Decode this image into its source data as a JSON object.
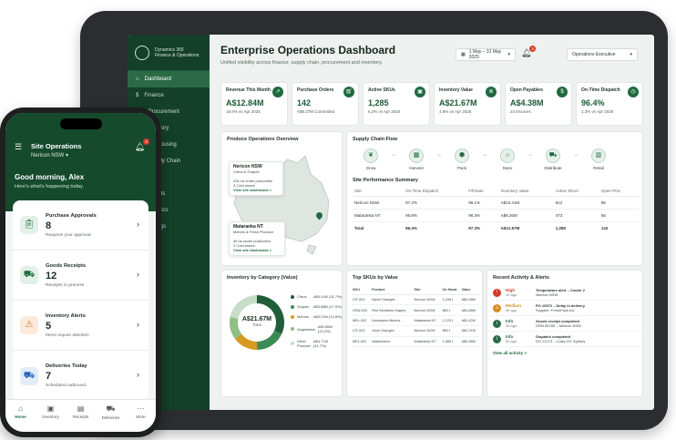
{
  "tablet": {
    "brand": {
      "line1": "Dynamics 365",
      "line2": "Finance & Operations"
    },
    "nav": [
      {
        "label": "Dashboard",
        "icon": "home-icon",
        "active": true
      },
      {
        "label": "Finance",
        "icon": "finance-icon"
      },
      {
        "label": "Procurement",
        "icon": "cart-icon"
      },
      {
        "label": "Inventory",
        "icon": "box-icon"
      },
      {
        "label": "Warehousing",
        "icon": "warehouse-icon"
      },
      {
        "label": "Supply Chain",
        "icon": "truck-icon"
      },
      {
        "label": "Sales",
        "icon": "tag-icon"
      },
      {
        "label": "Reports",
        "icon": "report-icon"
      },
      {
        "label": "Analytics",
        "icon": "chart-icon"
      },
      {
        "label": "Settings",
        "icon": "gear-icon"
      }
    ],
    "header": {
      "title": "Enterprise Operations Dashboard",
      "subtitle": "Unified visibility across finance, supply chain, procurement and inventory.",
      "date_range": "1 May – 31 May 2025",
      "notifications": "3",
      "role": "Operations Executive"
    },
    "kpis": [
      {
        "label": "Revenue This Month",
        "value": "A$12.84M",
        "delta": "18.6% vs Apr 2025",
        "icon": "chart-up-icon"
      },
      {
        "label": "Purchase Orders",
        "value": "142",
        "delta": "A$8.27M Committed",
        "icon": "cart-icon"
      },
      {
        "label": "Active SKUs",
        "value": "1,285",
        "delta": "6.2% vs Apr 2025",
        "icon": "box-icon"
      },
      {
        "label": "Inventory Value",
        "value": "A$21.67M",
        "delta": "4.8% vs Apr 2025",
        "icon": "database-icon"
      },
      {
        "label": "Open Payables",
        "value": "A$4.38M",
        "delta": "24 Invoices",
        "icon": "dollar-icon"
      },
      {
        "label": "On-Time Dispatch",
        "value": "96.4%",
        "delta": "1.3% vs Apr 2025",
        "icon": "clock-icon"
      }
    ],
    "map": {
      "title": "Produce Operations Overview",
      "site1": {
        "name": "Nericon NSW",
        "type": "Citrus & Grapes",
        "line1": "22k ha under production",
        "line2": "3 Cold stores",
        "link": "View site dashboard >"
      },
      "site2": {
        "name": "Mataranka NT",
        "type": "Melons & Fresh Produce",
        "line1": "4k ha under production",
        "line2": "2 Cold stores",
        "link": "View site dashboard >"
      }
    },
    "flow": {
      "title": "Supply Chain Flow",
      "steps": [
        {
          "label": "Grow",
          "icon": "sprout-icon"
        },
        {
          "label": "Harvest",
          "icon": "crate-icon"
        },
        {
          "label": "Pack",
          "icon": "package-icon"
        },
        {
          "label": "Store",
          "icon": "warehouse-icon"
        },
        {
          "label": "Distribute",
          "icon": "truck-icon"
        },
        {
          "label": "Retail",
          "icon": "store-icon"
        }
      ]
    },
    "performance": {
      "title": "Site Performance Summary",
      "headers": [
        "Site",
        "On-Time Dispatch",
        "Fill Rate",
        "Inventory Value",
        "Active SKUs",
        "Open POs"
      ],
      "rows": [
        [
          "Nericon NSW",
          "97.2%",
          "98.1%",
          "A$13.41M",
          "812",
          "86"
        ],
        [
          "Mataranka NT",
          "95.8%",
          "96.3%",
          "A$8.26M",
          "473",
          "56"
        ]
      ],
      "total": [
        "Total",
        "96.4%",
        "97.3%",
        "A$21.67M",
        "1,285",
        "142"
      ]
    },
    "inventory": {
      "title": "Inventory by Category (Value)",
      "center_value": "A$21.67M",
      "center_label": "Total",
      "legend": [
        {
          "name": "Citrus",
          "value": "A$5.41M (31.7%)",
          "color": "#1f5e36"
        },
        {
          "name": "Grapes",
          "value": "A$3.88M (17.9%)",
          "color": "#3e8a55"
        },
        {
          "name": "Melons",
          "value": "A$3.21M (14.8%)",
          "color": "#d59a1f"
        },
        {
          "name": "Vegetables",
          "value": "A$2.86M (13.2%)",
          "color": "#8fbf86"
        },
        {
          "name": "Other Produce",
          "value": "A$4.71M (21.7%)",
          "color": "#c7dcc7"
        }
      ],
      "chart_data": {
        "type": "pie",
        "categories": [
          "Citrus",
          "Grapes",
          "Melons",
          "Vegetables",
          "Other Produce"
        ],
        "values": [
          31.7,
          17.9,
          14.8,
          13.2,
          21.7
        ]
      }
    },
    "skus": {
      "title": "Top SKUs by Value",
      "headers": [
        "SKU",
        "Product",
        "Site",
        "On Hand",
        "Value"
      ],
      "rows": [
        [
          "CIT-001",
          "Navel Oranges",
          "Nericon NSW",
          "1,245 t",
          "A$2.08M"
        ],
        [
          "GRA-003",
          "Red Seedless Grapes",
          "Nericon NSW",
          "860 t",
          "A$1.86M"
        ],
        [
          "MEL-002",
          "Honeydew Melons",
          "Mataranka NT",
          "1,120 t",
          "A$1.42M"
        ],
        [
          "CIT-002",
          "Juice Oranges",
          "Nericon NSW",
          "980 t",
          "A$1.21M"
        ],
        [
          "MEL-001",
          "Watermelon",
          "Mataranka NT",
          "1,580 t",
          "A$0.98M"
        ]
      ]
    },
    "activity": {
      "title": "Recent Activity & Alerts",
      "items": [
        {
          "level": "High",
          "ago": "1h ago",
          "title": "Temperature alert – Cooler 2",
          "detail": "Nericon NSW",
          "color": "#d13b2a",
          "icon": "alert-icon"
        },
        {
          "level": "Medium",
          "ago": "3h ago",
          "title": "PO 10572 – Delay in delivery",
          "detail": "Supplier: FreshPack AU",
          "color": "#d88a1a",
          "icon": "warning-icon"
        },
        {
          "level": "Info",
          "ago": "3h ago",
          "title": "Goods receipt completed",
          "detail": "GRN 55789 – Nericon NSW",
          "color": "#2a6b45",
          "icon": "info-icon"
        },
        {
          "level": "Info",
          "ago": "5h ago",
          "title": "Dispatch completed",
          "detail": "DO 21273 – Coles DC Sydney",
          "color": "#2a6b45",
          "icon": "info-icon"
        }
      ],
      "view_all": "View all activity >"
    }
  },
  "phone": {
    "time": "9:41",
    "title": "Site Operations",
    "site": "Nericon NSW",
    "notifications": "3",
    "greeting": "Good morning, Alex",
    "greeting_sub": "Here's what's happening today.",
    "items": [
      {
        "label": "Purchase Approvals",
        "count": "8",
        "note": "Requires your approval",
        "icon": "clipboard-icon",
        "bg": "#e3f0e7",
        "color": "#1f6a3f"
      },
      {
        "label": "Goods Receipts",
        "count": "12",
        "note": "Receipts to process",
        "icon": "truck-icon",
        "bg": "#e3f0e7",
        "color": "#1f6a3f"
      },
      {
        "label": "Inventory Alerts",
        "count": "5",
        "note": "Items require attention",
        "icon": "warning-icon",
        "bg": "#fbeadb",
        "color": "#d4741a"
      },
      {
        "label": "Deliveries Today",
        "count": "7",
        "note": "Scheduled outbound",
        "icon": "delivery-icon",
        "bg": "#e2ecf8",
        "color": "#2a62b8"
      }
    ],
    "tabs": [
      {
        "label": "Home",
        "icon": "home-icon",
        "active": true
      },
      {
        "label": "Inventory",
        "icon": "box-icon"
      },
      {
        "label": "Receipts",
        "icon": "receipt-icon"
      },
      {
        "label": "Deliveries",
        "icon": "truck-icon"
      },
      {
        "label": "More",
        "icon": "more-icon"
      }
    ]
  }
}
